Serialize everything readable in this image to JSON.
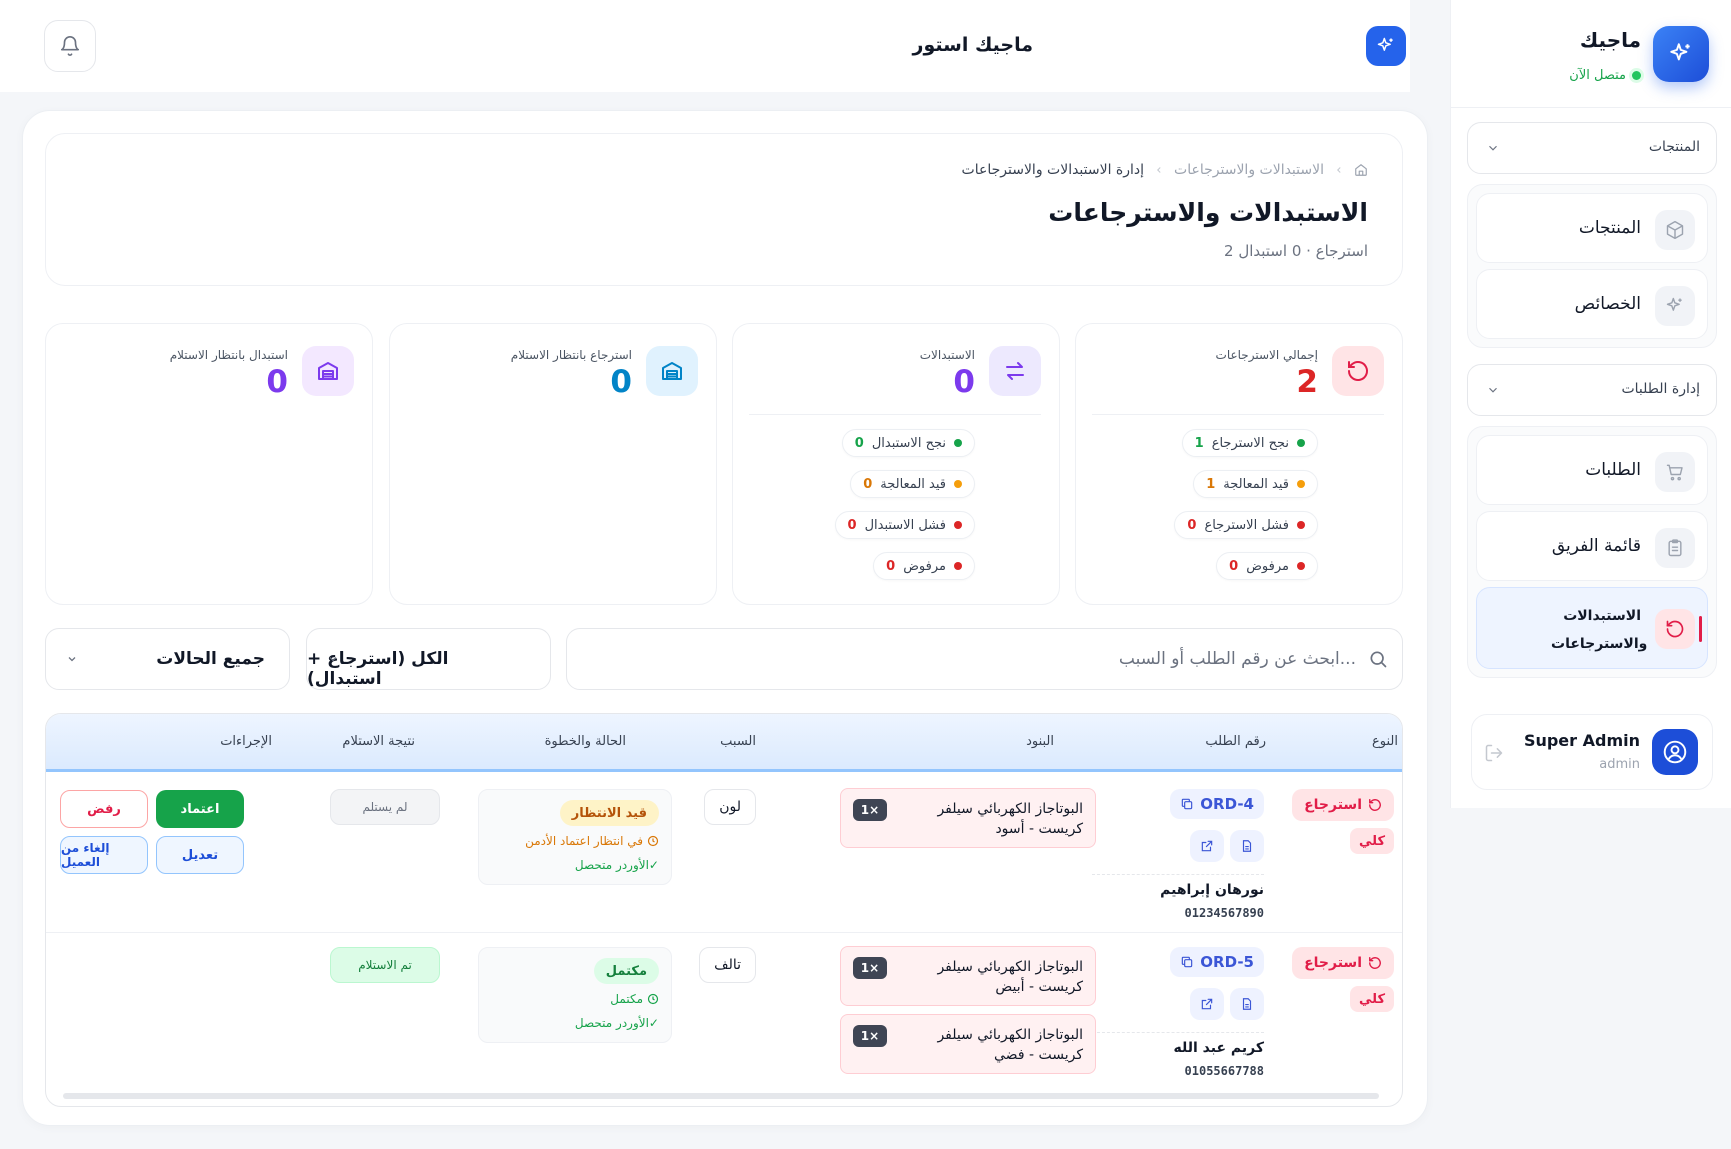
{
  "sidebar": {
    "brand_name": "ماجيك",
    "brand_status": "متصل الآن",
    "group_products": "المنتجات",
    "products_items": [
      "المنتجات",
      "الخصائص"
    ],
    "group_orders": "إدارة الطلبات",
    "orders_items": [
      "الطلبات",
      "قائمة الفريق",
      "الاستبدالات والاسترجاعات"
    ],
    "user_name": "Super Admin",
    "user_role": "admin"
  },
  "topbar": {
    "store_name": "ماجيك استور"
  },
  "header": {
    "breadcrumb": [
      "الاستبدالات والاسترجاعات",
      "إدارة الاستبدالات والاسترجاعات"
    ],
    "title": "الاستبدالات والاسترجاعات",
    "subtitle": "2 استرجاع · 0 استبدال"
  },
  "stats": [
    {
      "label": "إجمالي الاسترجاعات",
      "value": "2",
      "color": "#dc2626",
      "pills": [
        {
          "text": "نجح الاسترجاع",
          "count": "1",
          "dot": "#16a34a",
          "num_color": "#16a34a"
        },
        {
          "text": "قيد المعالجة",
          "count": "1",
          "dot": "#f59e0b",
          "num_color": "#d97706"
        },
        {
          "text": "فشل الاسترجاع",
          "count": "0",
          "dot": "#dc2626",
          "num_color": "#dc2626"
        },
        {
          "text": "مرفوض",
          "count": "0",
          "dot": "#dc2626",
          "num_color": "#dc2626"
        }
      ]
    },
    {
      "label": "الاستبدالات",
      "value": "0",
      "color": "#7c3aed",
      "pills": [
        {
          "text": "نجح الاستبدال",
          "count": "0",
          "dot": "#16a34a",
          "num_color": "#16a34a"
        },
        {
          "text": "قيد المعالجة",
          "count": "0",
          "dot": "#f59e0b",
          "num_color": "#d97706"
        },
        {
          "text": "فشل الاستبدال",
          "count": "0",
          "dot": "#dc2626",
          "num_color": "#dc2626"
        },
        {
          "text": "مرفوض",
          "count": "0",
          "dot": "#dc2626",
          "num_color": "#dc2626"
        }
      ]
    },
    {
      "label": "استرجاع بانتظار الاستلام",
      "value": "0",
      "color": "#0284c7"
    },
    {
      "label": "استبدال بانتظار الاستلام",
      "value": "0",
      "color": "#7c3aed"
    }
  ],
  "filters": {
    "search_placeholder": "ابحث عن رقم الطلب أو السبب...",
    "type_select": "الكل (استرجاع + استبدال)",
    "status_select": "جميع الحالات"
  },
  "table": {
    "headers": [
      "النوع",
      "رقم الطلب",
      "البنود",
      "السبب",
      "الحالة والخطوة",
      "نتيجة الاستلام",
      "الإجراءات"
    ],
    "rows": [
      {
        "type": "استرجاع",
        "scope": "كلي",
        "order": "ORD-4",
        "customer": "نورهان إبراهيم",
        "phone": "01234567890",
        "items": [
          {
            "name": "البوتاجاز الكهربائي سيلفر كريست - أسود",
            "qty": "1×"
          }
        ],
        "reason": "لون",
        "status_badge": "قيد الانتظار",
        "status_step": "في انتظار اعتماد الأدمن",
        "status_paid": "✓الأوردر متحصل",
        "receive": "لم يستلم",
        "actions": {
          "approve": "اعتماد",
          "reject": "رفض",
          "edit": "تعديل",
          "cancel": "إلغاء من العميل"
        }
      },
      {
        "type": "استرجاع",
        "scope": "كلي",
        "order": "ORD-5",
        "customer": "كريم عبد الله",
        "phone": "01055667788",
        "items": [
          {
            "name": "البوتاجاز الكهربائي سيلفر كريست - أبيض",
            "qty": "1×"
          },
          {
            "name": "البوتاجاز الكهربائي سيلفر كريست - فضي",
            "qty": "1×"
          }
        ],
        "reason": "تالف",
        "status_badge": "مكتمل",
        "status_step": "مكتمل",
        "status_paid": "✓الأوردر متحصل",
        "receive": "تم الاستلام"
      }
    ]
  },
  "colors": {
    "primary": "#2563eb",
    "danger": "#e11d48",
    "success": "#16a34a",
    "warning": "#d97706"
  }
}
